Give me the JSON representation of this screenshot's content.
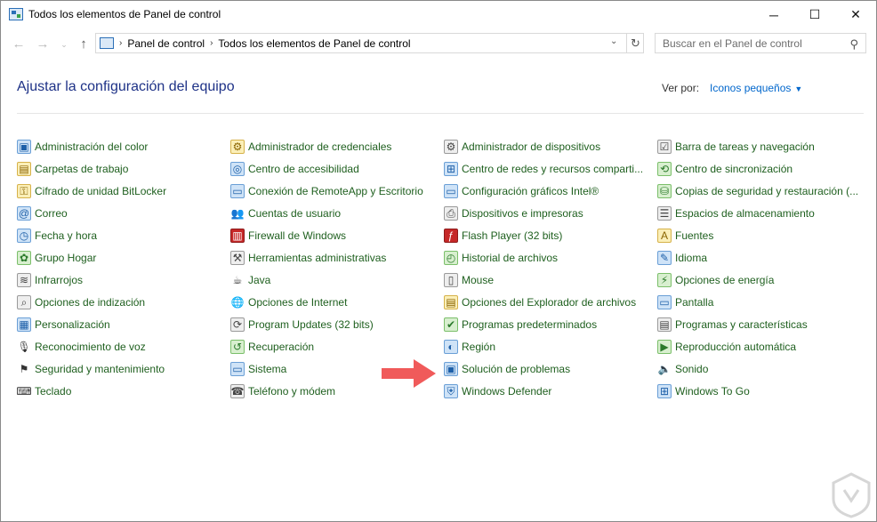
{
  "window": {
    "title": "Todos los elementos de Panel de control",
    "controls": {
      "minimize": "─",
      "maximize": "☐",
      "close": "✕"
    }
  },
  "nav": {
    "back": "←",
    "forward": "→",
    "recent": "⌄",
    "up": "↑",
    "breadcrumbs": [
      "Panel de control",
      "Todos los elementos de Panel de control"
    ],
    "breadcrumb_sep": "›",
    "dropdown": "⌄",
    "refresh": "↻"
  },
  "search": {
    "placeholder": "Buscar en el Panel de control",
    "icon": "⚲"
  },
  "header": {
    "title": "Ajustar la configuración del equipo",
    "view_by_label": "Ver por:",
    "view_mode": "Iconos pequeños",
    "view_caret": "▼"
  },
  "columns": [
    [
      {
        "label": "Administración del color",
        "icon": "color-management-icon",
        "glyph": "▣",
        "tone": "blue"
      },
      {
        "label": "Carpetas de trabajo",
        "icon": "work-folders-icon",
        "glyph": "▤",
        "tone": "yellow"
      },
      {
        "label": "Cifrado de unidad BitLocker",
        "icon": "bitlocker-icon",
        "glyph": "⚿",
        "tone": "yellow"
      },
      {
        "label": "Correo",
        "icon": "mail-icon",
        "glyph": "@",
        "tone": "blue"
      },
      {
        "label": "Fecha y hora",
        "icon": "date-time-icon",
        "glyph": "◷",
        "tone": "blue"
      },
      {
        "label": "Grupo Hogar",
        "icon": "homegroup-icon",
        "glyph": "✿",
        "tone": "green"
      },
      {
        "label": "Infrarrojos",
        "icon": "infrared-icon",
        "glyph": "≋",
        "tone": "gray"
      },
      {
        "label": "Opciones de indización",
        "icon": "indexing-icon",
        "glyph": "⌕",
        "tone": "gray"
      },
      {
        "label": "Personalización",
        "icon": "personalization-icon",
        "glyph": "▦",
        "tone": "blue"
      },
      {
        "label": "Reconocimiento de voz",
        "icon": "speech-icon",
        "glyph": "🎙",
        "tone": "plain"
      },
      {
        "label": "Seguridad y mantenimiento",
        "icon": "security-flag-icon",
        "glyph": "⚑",
        "tone": "plain"
      },
      {
        "label": "Teclado",
        "icon": "keyboard-icon",
        "glyph": "⌨",
        "tone": "plain"
      }
    ],
    [
      {
        "label": "Administrador de credenciales",
        "icon": "credentials-icon",
        "glyph": "⚙",
        "tone": "yellow"
      },
      {
        "label": "Centro de accesibilidad",
        "icon": "accessibility-icon",
        "glyph": "◎",
        "tone": "blue"
      },
      {
        "label": "Conexión de RemoteApp y Escritorio",
        "icon": "remoteapp-icon",
        "glyph": "▭",
        "tone": "blue"
      },
      {
        "label": "Cuentas de usuario",
        "icon": "user-accounts-icon",
        "glyph": "👥",
        "tone": "plain"
      },
      {
        "label": "Firewall de Windows",
        "icon": "firewall-icon",
        "glyph": "▥",
        "tone": "red"
      },
      {
        "label": "Herramientas administrativas",
        "icon": "admin-tools-icon",
        "glyph": "⚒",
        "tone": "gray"
      },
      {
        "label": "Java",
        "icon": "java-icon",
        "glyph": "☕",
        "tone": "plain"
      },
      {
        "label": "Opciones de Internet",
        "icon": "internet-options-icon",
        "glyph": "🌐",
        "tone": "plain"
      },
      {
        "label": "Program Updates (32 bits)",
        "icon": "program-updates-icon",
        "glyph": "⟳",
        "tone": "gray"
      },
      {
        "label": "Recuperación",
        "icon": "recovery-icon",
        "glyph": "↺",
        "tone": "green"
      },
      {
        "label": "Sistema",
        "icon": "system-icon",
        "glyph": "▭",
        "tone": "blue"
      },
      {
        "label": "Teléfono y módem",
        "icon": "phone-modem-icon",
        "glyph": "☎",
        "tone": "gray"
      }
    ],
    [
      {
        "label": "Administrador de dispositivos",
        "icon": "device-manager-icon",
        "glyph": "⚙",
        "tone": "gray"
      },
      {
        "label": "Centro de redes y recursos comparti...",
        "icon": "network-center-icon",
        "glyph": "⊞",
        "tone": "blue"
      },
      {
        "label": "Configuración gráficos Intel®",
        "icon": "intel-graphics-icon",
        "glyph": "▭",
        "tone": "blue"
      },
      {
        "label": "Dispositivos e impresoras",
        "icon": "printers-icon",
        "glyph": "⎙",
        "tone": "gray"
      },
      {
        "label": "Flash Player (32 bits)",
        "icon": "flash-icon",
        "glyph": "ƒ",
        "tone": "red"
      },
      {
        "label": "Historial de archivos",
        "icon": "file-history-icon",
        "glyph": "◴",
        "tone": "green"
      },
      {
        "label": "Mouse",
        "icon": "mouse-icon",
        "glyph": "▯",
        "tone": "gray"
      },
      {
        "label": "Opciones del Explorador de archivos",
        "icon": "explorer-options-icon",
        "glyph": "▤",
        "tone": "yellow"
      },
      {
        "label": "Programas predeterminados",
        "icon": "default-programs-icon",
        "glyph": "✔",
        "tone": "green"
      },
      {
        "label": "Región",
        "icon": "region-icon",
        "glyph": "◐",
        "tone": "blue"
      },
      {
        "label": "Solución de problemas",
        "icon": "troubleshooting-icon",
        "glyph": "▣",
        "tone": "blue"
      },
      {
        "label": "Windows Defender",
        "icon": "windows-defender-icon",
        "glyph": "⛨",
        "tone": "blue"
      }
    ],
    [
      {
        "label": "Barra de tareas y navegación",
        "icon": "taskbar-icon",
        "glyph": "☑",
        "tone": "gray"
      },
      {
        "label": "Centro de sincronización",
        "icon": "sync-center-icon",
        "glyph": "⟲",
        "tone": "green"
      },
      {
        "label": "Copias de seguridad y restauración (...",
        "icon": "backup-icon",
        "glyph": "⛁",
        "tone": "green"
      },
      {
        "label": "Espacios de almacenamiento",
        "icon": "storage-spaces-icon",
        "glyph": "☰",
        "tone": "gray"
      },
      {
        "label": "Fuentes",
        "icon": "fonts-icon",
        "glyph": "A",
        "tone": "yellow"
      },
      {
        "label": "Idioma",
        "icon": "language-icon",
        "glyph": "✎",
        "tone": "blue"
      },
      {
        "label": "Opciones de energía",
        "icon": "power-options-icon",
        "glyph": "⚡",
        "tone": "green"
      },
      {
        "label": "Pantalla",
        "icon": "display-icon",
        "glyph": "▭",
        "tone": "blue"
      },
      {
        "label": "Programas y características",
        "icon": "programs-features-icon",
        "glyph": "▤",
        "tone": "gray"
      },
      {
        "label": "Reproducción automática",
        "icon": "autoplay-icon",
        "glyph": "▶",
        "tone": "green"
      },
      {
        "label": "Sonido",
        "icon": "sound-icon",
        "glyph": "🔈",
        "tone": "plain"
      },
      {
        "label": "Windows To Go",
        "icon": "windows-to-go-icon",
        "glyph": "⊞",
        "tone": "blue"
      }
    ]
  ],
  "annotation": {
    "arrow_color": "#f05a5a",
    "points_to": "Solución de problemas"
  }
}
